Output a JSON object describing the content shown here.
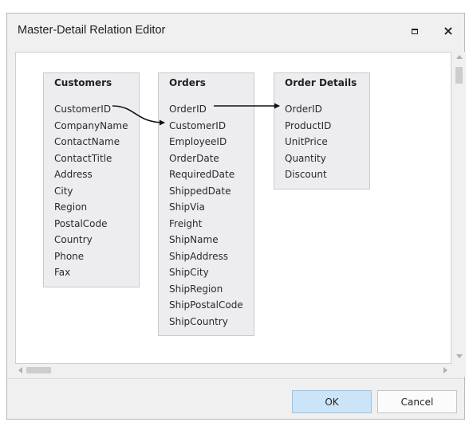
{
  "window": {
    "title": "Master-Detail Relation Editor",
    "maximize_icon": "maximize-icon",
    "close_icon": "close-icon",
    "close_glyph": "×"
  },
  "tables": [
    {
      "name": "Customers",
      "fields": [
        "CustomerID",
        "CompanyName",
        "ContactName",
        "ContactTitle",
        "Address",
        "City",
        "Region",
        "PostalCode",
        "Country",
        "Phone",
        "Fax"
      ]
    },
    {
      "name": "Orders",
      "fields": [
        "OrderID",
        "CustomerID",
        "EmployeeID",
        "OrderDate",
        "RequiredDate",
        "ShippedDate",
        "ShipVia",
        "Freight",
        "ShipName",
        "ShipAddress",
        "ShipCity",
        "ShipRegion",
        "ShipPostalCode",
        "ShipCountry"
      ]
    },
    {
      "name": "Order Details",
      "fields": [
        "OrderID",
        "ProductID",
        "UnitPrice",
        "Quantity",
        "Discount"
      ]
    }
  ],
  "relations": [
    {
      "from_table": "Customers",
      "from_field": "CustomerID",
      "to_table": "Orders",
      "to_field": "CustomerID"
    },
    {
      "from_table": "Orders",
      "from_field": "OrderID",
      "to_table": "Order Details",
      "to_field": "OrderID"
    }
  ],
  "buttons": {
    "ok": "OK",
    "cancel": "Cancel"
  },
  "colors": {
    "ok_background": "#cce4f7",
    "ok_border": "#99c4e8",
    "table_background": "#ededf0"
  }
}
